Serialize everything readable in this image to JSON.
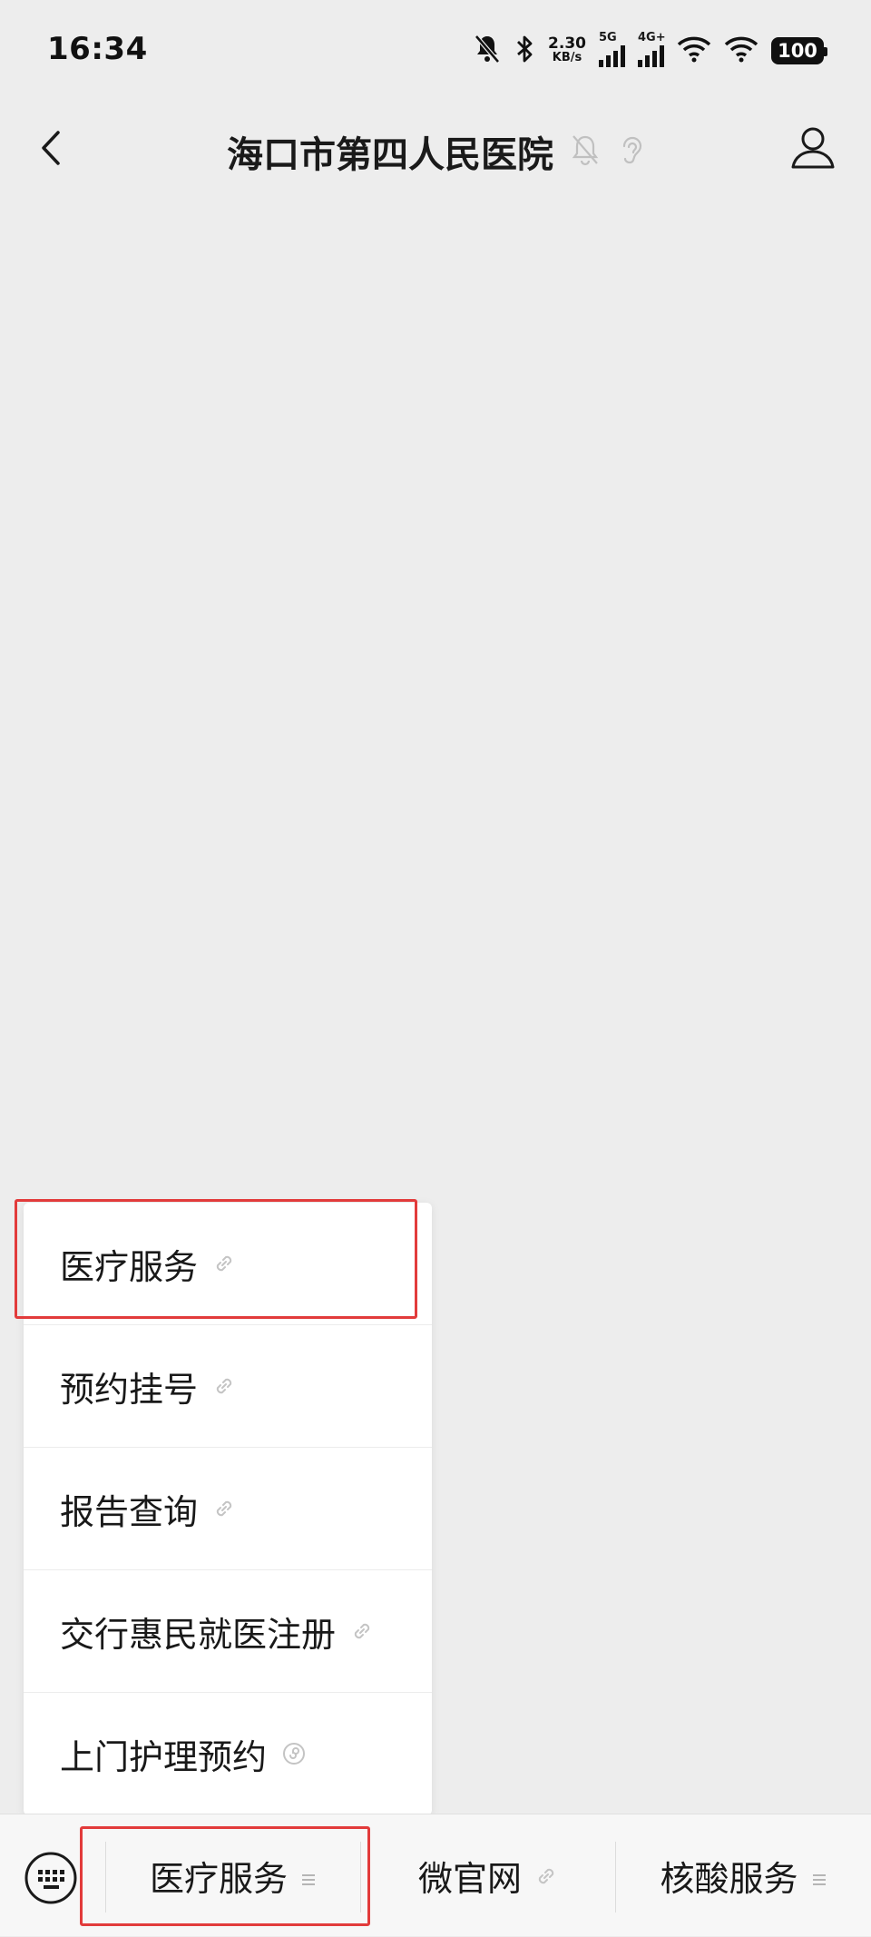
{
  "status_bar": {
    "time": "16:34",
    "net_speed_value": "2.30",
    "net_speed_unit": "KB/s",
    "signal1_label": "5G",
    "signal2_label": "4G+",
    "battery": "100"
  },
  "nav": {
    "title": "海口市第四人民医院"
  },
  "menu": {
    "items": [
      {
        "label": "医疗服务",
        "icon": "link-icon"
      },
      {
        "label": "预约挂号",
        "icon": "link-icon"
      },
      {
        "label": "报告查询",
        "icon": "link-icon"
      },
      {
        "label": "交行惠民就医注册",
        "icon": "link-icon"
      },
      {
        "label": "上门护理预约",
        "icon": "mini-program-icon"
      }
    ]
  },
  "bottom_menu": {
    "tabs": [
      {
        "label": "医疗服务",
        "icon": "menu-lines-icon"
      },
      {
        "label": "微官网",
        "icon": "link-icon"
      },
      {
        "label": "核酸服务",
        "icon": "menu-lines-icon"
      }
    ]
  },
  "colors": {
    "highlight": "#e23b3b",
    "background": "#ededed"
  }
}
